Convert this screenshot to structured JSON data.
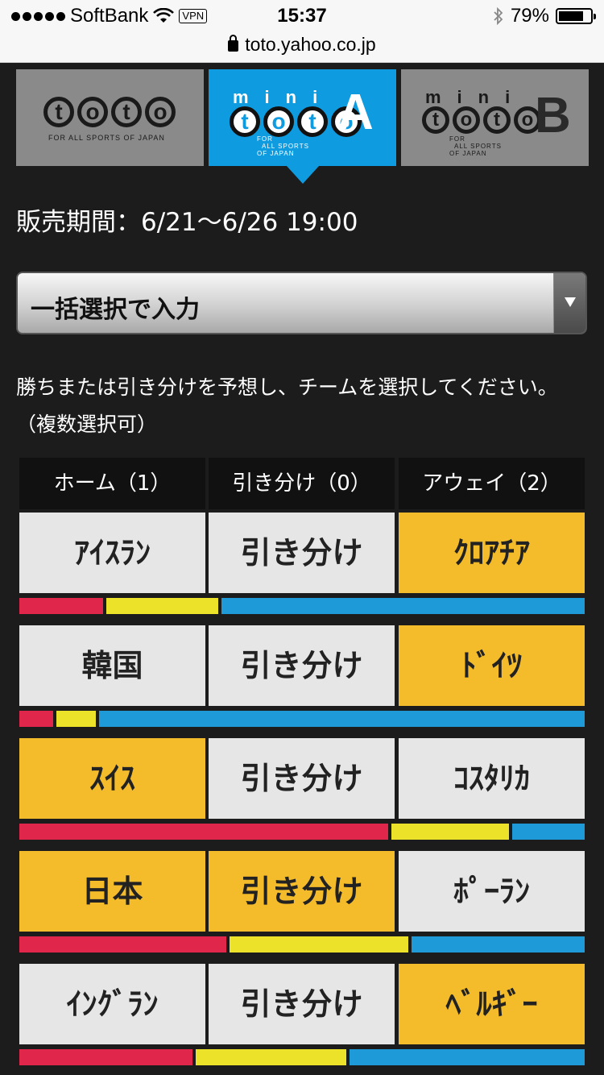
{
  "status_bar": {
    "carrier": "SoftBank",
    "vpn": "VPN",
    "time": "15:37",
    "battery": "79%",
    "battery_fraction": 0.79
  },
  "browser": {
    "url": "toto.yahoo.co.jp"
  },
  "tabs": [
    {
      "name": "toto",
      "logo_text": "toto",
      "tagline": "FOR ALL SPORTS OF JAPAN",
      "selected": false
    },
    {
      "name": "mini toto A",
      "mini_text": "mini",
      "logo_text": "toto",
      "tagline_line1": "FOR",
      "tagline_line2": "ALL SPORTS",
      "tagline_line3": "OF JAPAN",
      "letter": "A",
      "selected": true
    },
    {
      "name": "mini toto B",
      "mini_text": "mini",
      "logo_text": "toto",
      "tagline_line1": "FOR",
      "tagline_line2": "ALL SPORTS",
      "tagline_line3": "OF JAPAN",
      "letter": "B",
      "selected": false
    }
  ],
  "sale_period": "販売期間：6/21〜6/26 19:00",
  "bulk_select": {
    "label": "一括選択で入力"
  },
  "instruction": "勝ちまたは引き分けを予想し、チームを選択してください。（複数選択可）",
  "colors": {
    "home": "#e0264a",
    "draw": "#ece22a",
    "away": "#1e9ad9",
    "selected": "#f4bc2b",
    "tab_active": "#0f9be0"
  },
  "columns": [
    "ホーム（1）",
    "引き分け（0）",
    "アウェイ（2）"
  ],
  "matches": [
    {
      "home": "ｱｲｽﾗﾝ",
      "draw": "引き分け",
      "away": "ｸﾛｱﾁｱ",
      "selected": [
        "away"
      ],
      "vote_share": {
        "home": 0.15,
        "draw": 0.2,
        "away": 0.65
      }
    },
    {
      "home": "韓国",
      "draw": "引き分け",
      "away": "ﾄﾞｲﾂ",
      "selected": [
        "away"
      ],
      "vote_share": {
        "home": 0.06,
        "draw": 0.07,
        "away": 0.87
      }
    },
    {
      "home": "ｽｲｽ",
      "draw": "引き分け",
      "away": "ｺｽﾀﾘｶ",
      "selected": [
        "home"
      ],
      "vote_share": {
        "home": 0.66,
        "draw": 0.21,
        "away": 0.13
      }
    },
    {
      "home": "日本",
      "draw": "引き分け",
      "away": "ﾎﾟｰﾗﾝ",
      "selected": [
        "home",
        "draw"
      ],
      "vote_share": {
        "home": 0.37,
        "draw": 0.32,
        "away": 0.31
      }
    },
    {
      "home": "ｲﾝｸﾞﾗﾝ",
      "draw": "引き分け",
      "away": "ﾍﾞﾙｷﾞｰ",
      "selected": [
        "away"
      ],
      "vote_share": {
        "home": 0.31,
        "draw": 0.27,
        "away": 0.42
      }
    }
  ]
}
